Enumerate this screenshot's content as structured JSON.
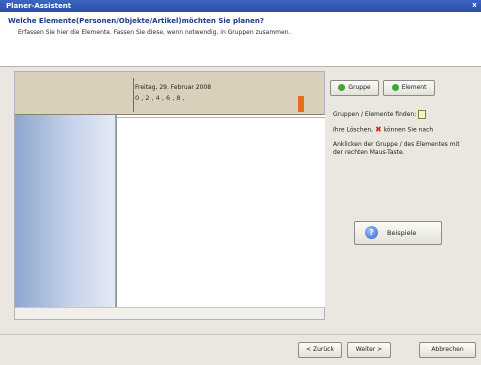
{
  "window": {
    "title": "Planer-Assistent",
    "close_glyph": "x"
  },
  "header": {
    "question": "Welche Elemente(Personen/Objekte/Artikel)möchten Sie planen?",
    "instruction": "Erfassen Sie hier die Elemente. Fassen Sie diese, wenn notwendig, in Gruppen zusammen."
  },
  "planner": {
    "date_label": "Freitag, 29. Februar 2008",
    "hour_ticks": "0 , 2 , 4 , 6 , 8 ,",
    "marker_color": "#e56c1c"
  },
  "toolbar": {
    "add_group_label": "Gruppe",
    "add_element_label": "Element"
  },
  "right_panel": {
    "find_text": "Gruppen / Elemente finden:",
    "delete_text_prefix": "Ihre Löschen,",
    "delete_text_suffix": "können Sie nach",
    "context_text": "Anklicken der Gruppe / des Elementes mit der rechten Maus-Taste.",
    "examples_label": "Beispiele"
  },
  "footer": {
    "back_label": "< Zurück",
    "next_label": "Weiter >",
    "cancel_label": "Abbrechen"
  },
  "icons": {
    "add_group": "green-plus-icon",
    "add_element": "green-plus-icon",
    "find": "find-icon",
    "delete": "red-x-icon",
    "examples": "help-icon"
  }
}
